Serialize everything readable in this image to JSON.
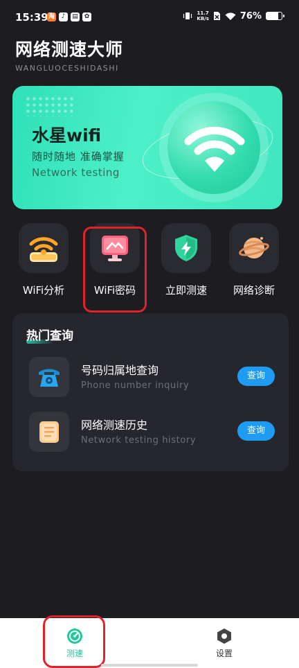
{
  "status_bar": {
    "time": "15:39",
    "notification_glyphs": [
      "淘",
      "♪",
      "▤",
      "✿"
    ],
    "net_speed_value": "11.7",
    "net_speed_unit": "KB/s",
    "battery": "76%",
    "battery_level": 0.76
  },
  "header": {
    "title": "网络测速大师",
    "subtitle": "WANGLUOCESHIDASHI"
  },
  "banner": {
    "title": "水星wifi",
    "subtitle": "随时随地 准确掌握",
    "english": "Network testing",
    "accent_color": "#3fe6bf"
  },
  "features": [
    {
      "label": "WiFi分析",
      "icon": "router-wifi-icon"
    },
    {
      "label": "WiFi密码",
      "icon": "monitor-icon"
    },
    {
      "label": "立即测速",
      "icon": "shield-bolt-icon"
    },
    {
      "label": "网络诊断",
      "icon": "planet-icon"
    }
  ],
  "hot_query": {
    "title": "热门查询",
    "items": [
      {
        "name": "号码归属地查询",
        "english": "Phone number inquiry",
        "button": "查询",
        "icon": "telephone-icon"
      },
      {
        "name": "网络测速历史",
        "english": "Network testing history",
        "button": "查询",
        "icon": "document-icon"
      }
    ]
  },
  "bottom_nav": {
    "items": [
      {
        "label": "测速",
        "icon": "speedometer-icon",
        "active": true
      },
      {
        "label": "设置",
        "icon": "hexagon-gear-icon",
        "active": false
      }
    ],
    "active_color": "#1fc99c",
    "inactive_color": "#333333"
  },
  "colors": {
    "background": "#1c1c21",
    "card": "#26262d",
    "accent_blue": "#1e9bf2",
    "highlight_red": "#e0232b"
  }
}
